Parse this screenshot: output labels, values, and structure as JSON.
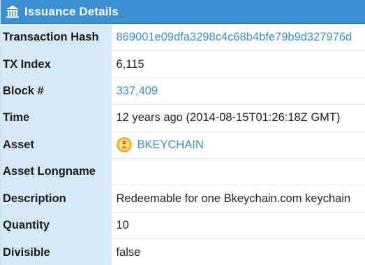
{
  "panel": {
    "title": "Issuance Details",
    "header_icon": "bank-icon"
  },
  "rows": {
    "tx_hash": {
      "label": "Transaction Hash",
      "value": "869001e09dfa3298c4c68b4bfe79b9d327976d"
    },
    "tx_index": {
      "label": "TX Index",
      "value": "6,115"
    },
    "block": {
      "label": "Block #",
      "value": "337,409"
    },
    "time": {
      "label": "Time",
      "value": "12 years ago (2014-08-15T01:26:18Z GMT)"
    },
    "asset": {
      "label": "Asset",
      "value": "BKEYCHAIN",
      "icon": "asset-token-icon"
    },
    "asset_longname": {
      "label": "Asset Longname",
      "value": ""
    },
    "description": {
      "label": "Description",
      "value": "Redeemable for one Bkeychain.com keychain"
    },
    "quantity": {
      "label": "Quantity",
      "value": "10"
    },
    "divisible": {
      "label": "Divisible",
      "value": "false"
    }
  },
  "colors": {
    "header_bg": "#3d8fd3",
    "label_bg": "#d6e9f7",
    "link": "#3d8fd3"
  }
}
